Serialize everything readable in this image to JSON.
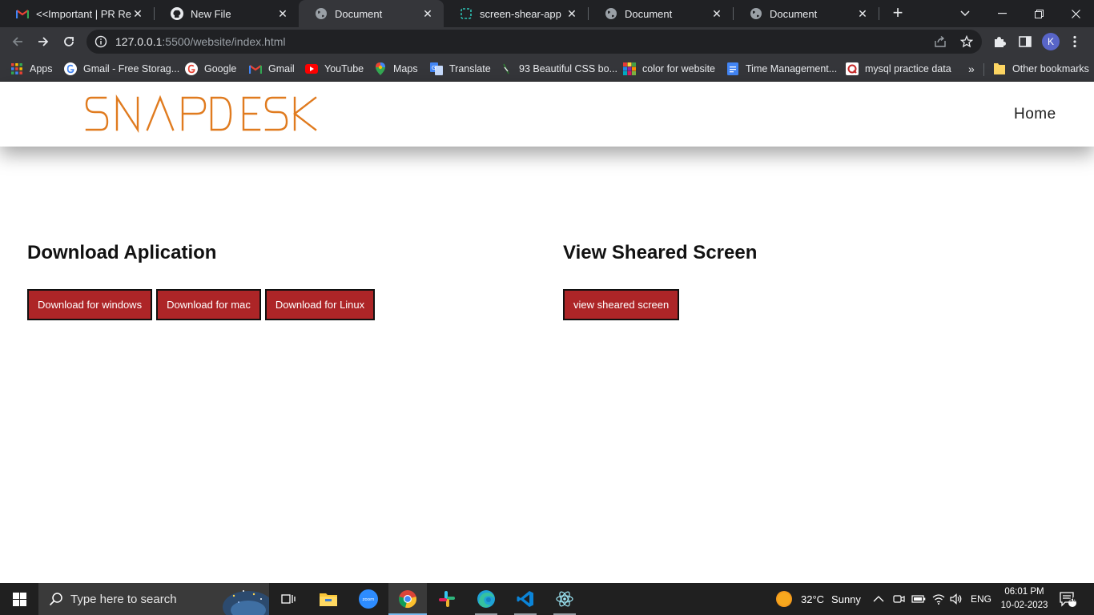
{
  "browser": {
    "tabs": [
      {
        "title": "<<Important | PR Requ",
        "icon": "gmail-icon",
        "active": false
      },
      {
        "title": "New File",
        "icon": "github-icon",
        "active": false
      },
      {
        "title": "Document",
        "icon": "globe-icon",
        "active": true
      },
      {
        "title": "screen-shear-app · W",
        "icon": "replit-icon",
        "active": false
      },
      {
        "title": "Document",
        "icon": "globe-icon",
        "active": false
      },
      {
        "title": "Document",
        "icon": "globe-icon",
        "active": false
      }
    ],
    "url_host": "127.0.0.1",
    "url_rest": ":5500/website/index.html",
    "profile_initial": "K",
    "bookmarks": [
      {
        "label": "Apps",
        "icon": "apps-grid-icon"
      },
      {
        "label": "Gmail - Free Storag...",
        "icon": "google-icon"
      },
      {
        "label": "Google",
        "icon": "google-icon"
      },
      {
        "label": "Gmail",
        "icon": "gmail-icon"
      },
      {
        "label": "YouTube",
        "icon": "youtube-icon"
      },
      {
        "label": "Maps",
        "icon": "maps-icon"
      },
      {
        "label": "Translate",
        "icon": "translate-icon"
      },
      {
        "label": "93 Beautiful CSS bo...",
        "icon": "css-icon"
      },
      {
        "label": "color for website",
        "icon": "color-grid-icon"
      },
      {
        "label": "Time Management...",
        "icon": "docs-icon"
      },
      {
        "label": "mysql practice data",
        "icon": "mysql-icon"
      }
    ],
    "other_bookmarks": "Other bookmarks",
    "overflow": "»"
  },
  "site": {
    "logo": "SNAP DESK",
    "nav_home": "Home",
    "download_title": "Download Aplication",
    "download_buttons": [
      "Download for windows",
      "Download for mac",
      "Download for Linux"
    ],
    "view_title": "View Sheared Screen",
    "view_button": "view sheared screen"
  },
  "taskbar": {
    "search_placeholder": "Type here to search",
    "weather_temp": "32°C",
    "weather_text": "Sunny",
    "language": "ENG",
    "time": "06:01 PM",
    "date": "10-02-2023",
    "notifications": "10"
  },
  "colors": {
    "logo": "#e07b1f",
    "button_bg": "#ad2527",
    "chrome_dark": "#202124",
    "chrome_mid": "#35363a"
  }
}
